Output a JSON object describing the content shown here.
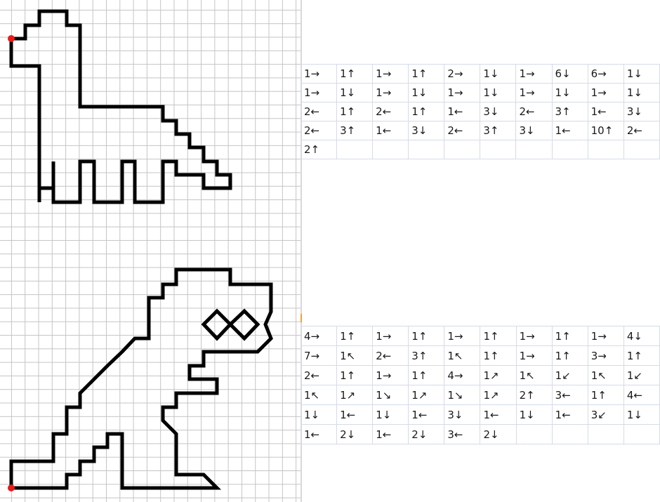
{
  "colors": {
    "grid_line": "#c4c4c4",
    "outline": "#000000",
    "start_marker": "#e81b1b",
    "table_border": "#d4dbe8"
  },
  "drawings": [
    {
      "name": "long-neck-dinosaur",
      "start_marker": "red-dot"
    },
    {
      "name": "t-rex-dinosaur",
      "start_marker": "red-dot"
    }
  ],
  "instructions_1": {
    "rows": [
      [
        "1→",
        "1↑",
        "1→",
        "1↑",
        "2→",
        "1↓",
        "1→",
        "6↓",
        "6→",
        "1↓"
      ],
      [
        "1→",
        "1↓",
        "1→",
        "1↓",
        "1→",
        "1↓",
        "1→",
        "1↓",
        "1→",
        "1↓"
      ],
      [
        "2←",
        "1↑",
        "2←",
        "1↑",
        "1←",
        "3↓",
        "2←",
        "3↑",
        "1←",
        "3↓"
      ],
      [
        "2←",
        "3↑",
        "1←",
        "3↓",
        "2←",
        "3↑",
        "3↓",
        "1←",
        "10↑",
        "2←"
      ],
      [
        "2↑",
        "",
        "",
        "",
        "",
        "",
        "",
        "",
        "",
        ""
      ]
    ]
  },
  "instructions_2": {
    "rows": [
      [
        "4→",
        "1↑",
        "1→",
        "1↑",
        "1→",
        "1↑",
        "1→",
        "1↑",
        "1→",
        "4↓"
      ],
      [
        "7→",
        "1↖",
        "2←",
        "3↑",
        "1↖",
        "1↑",
        "1→",
        "1↑",
        "3→",
        "1↑"
      ],
      [
        "2←",
        "1↑",
        "1→",
        "1↑",
        "4→",
        "1↗",
        "1↖",
        "1↙",
        "1↖",
        "1↙"
      ],
      [
        "1↖",
        "1↗",
        "1↘",
        "1↗",
        "1↘",
        "1↗",
        "2↑",
        "3←",
        "1↑",
        "4←"
      ],
      [
        "1↓",
        "1←",
        "1↓",
        "1←",
        "3↓",
        "1←",
        "1↓",
        "1←",
        "3↙",
        "1↓"
      ],
      [
        "1←",
        "2↓",
        "1←",
        "2↓",
        "3←",
        "2↓",
        "",
        "",
        "",
        ""
      ]
    ]
  }
}
